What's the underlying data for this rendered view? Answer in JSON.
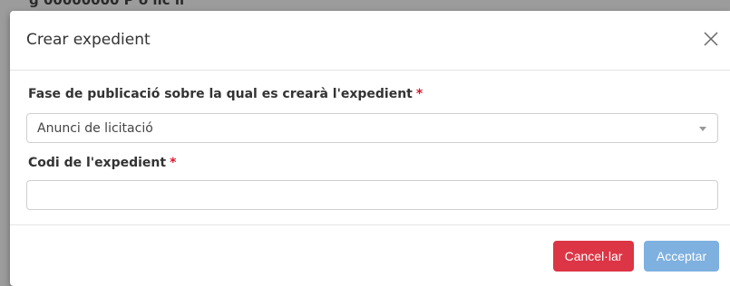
{
  "background": {
    "partial_text": "g    00000000 P o llc    ll"
  },
  "modal": {
    "title": "Crear expedient",
    "close_icon": "close-icon",
    "fields": {
      "phase": {
        "label": "Fase de publicació sobre la qual es crearà l'expedient",
        "required_mark": "*",
        "selected": "Anunci de licitació"
      },
      "code": {
        "label": "Codi de l'expedient",
        "required_mark": "*",
        "value": "",
        "placeholder": ""
      }
    },
    "buttons": {
      "cancel": "Cancel·lar",
      "accept": "Acceptar"
    }
  },
  "colors": {
    "cancel": "#dc3545",
    "accept_disabled": "#7eb0e0",
    "required": "#d9182e"
  }
}
